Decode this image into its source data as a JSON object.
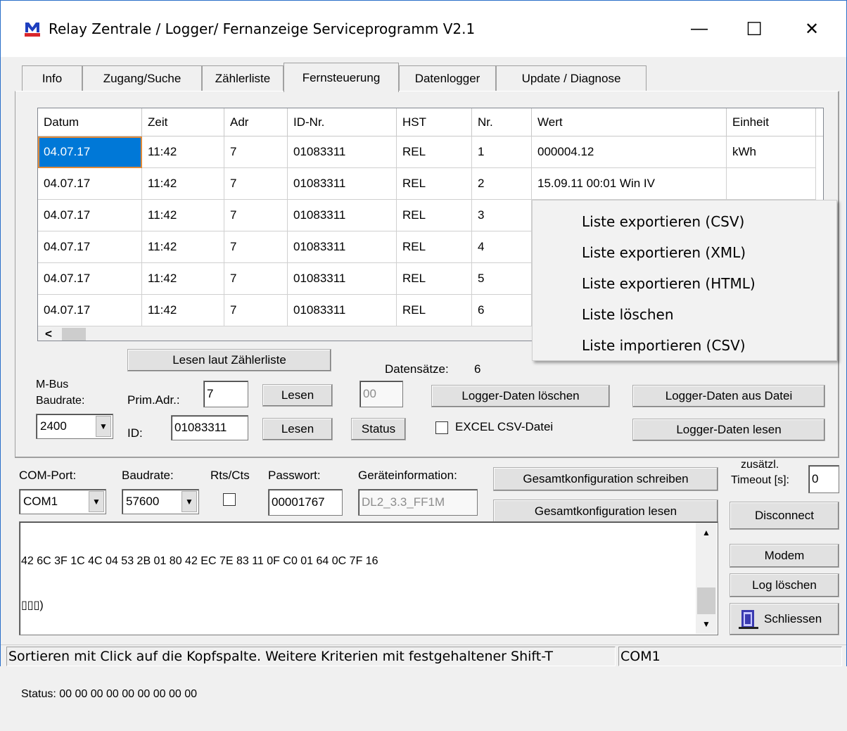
{
  "window": {
    "title": "Relay Zentrale / Logger/ Fernanzeige Serviceprogramm  V2.1",
    "minimize": "—",
    "maximize": "☐",
    "close": "✕"
  },
  "tabs": [
    {
      "label": "Info",
      "active": false
    },
    {
      "label": "Zugang/Suche",
      "active": false
    },
    {
      "label": "Zählerliste",
      "active": false
    },
    {
      "label": "Fernsteuerung",
      "active": true
    },
    {
      "label": "Datenlogger",
      "active": false
    },
    {
      "label": "Update / Diagnose",
      "active": false
    }
  ],
  "grid": {
    "columns": [
      "Datum",
      "Zeit",
      "Adr",
      "ID-Nr.",
      "HST",
      "Nr.",
      "Wert",
      "Einheit"
    ],
    "rows": [
      [
        "04.07.17",
        "11:42",
        "7",
        "01083311",
        "REL",
        "1",
        "000004.12",
        "kWh"
      ],
      [
        "04.07.17",
        "11:42",
        "7",
        "01083311",
        "REL",
        "2",
        "15.09.11 00:01 Win IV",
        ""
      ],
      [
        "04.07.17",
        "11:42",
        "7",
        "01083311",
        "REL",
        "3",
        "",
        ""
      ],
      [
        "04.07.17",
        "11:42",
        "7",
        "01083311",
        "REL",
        "4",
        "",
        ""
      ],
      [
        "04.07.17",
        "11:42",
        "7",
        "01083311",
        "REL",
        "5",
        "",
        ""
      ],
      [
        "04.07.17",
        "11:42",
        "7",
        "01083311",
        "REL",
        "6",
        "",
        ""
      ]
    ],
    "scroll_left_arrow": "<"
  },
  "context_menu": [
    "Liste exportieren (CSV)",
    "Liste exportieren (XML)",
    "Liste exportieren (HTML)",
    "Liste löschen",
    "Liste importieren (CSV)"
  ],
  "controls": {
    "lesen_laut_zaehlerliste": "Lesen laut Zählerliste",
    "datensaetze_label": "Datensätze:",
    "datensaetze_count": "6",
    "mbus_label_1": "M-Bus",
    "mbus_label_2": "Baudrate:",
    "mbus_baudrate": "2400",
    "prim_adr_label": "Prim.Adr.:",
    "prim_adr_value": "7",
    "id_label": "ID:",
    "id_value": "01083311",
    "lesen_1": "Lesen",
    "lesen_2": "Lesen",
    "small_field": "00",
    "status_button": "Status",
    "logger_loeschen": "Logger-Daten löschen",
    "excel_csv": "EXCEL CSV-Datei",
    "logger_aus_datei": "Logger-Daten aus Datei",
    "logger_lesen": "Logger-Daten lesen"
  },
  "connection": {
    "com_port_label": "COM-Port:",
    "com_port_value": "COM1",
    "baudrate_label": "Baudrate:",
    "baudrate_value": "57600",
    "rts_cts_label": "Rts/Cts",
    "passwort_label": "Passwort:",
    "passwort_value": "00001767",
    "geraeteinfo_label": "Geräteinformation:",
    "geraeteinfo_value": "DL2_3.3_FF1M",
    "gesamt_schreiben": "Gesamtkonfiguration schreiben",
    "gesamt_lesen": "Gesamtkonfiguration lesen",
    "timeout_label_1": "zusätzl.",
    "timeout_label_2": "Timeout [s]:",
    "timeout_value": "0",
    "disconnect": "Disconnect",
    "modem": "Modem",
    "log_loeschen": "Log löschen",
    "schliessen": "Schliessen"
  },
  "log": {
    "lines": [
      "42 6C 3F 1C 4C 04 53 2B 01 80 42 EC 7E 83 11 0F C0 01 64 0C 7F 16",
      "▯▯▯)",
      "▯▯▯)",
      "Status: 00 00 00 00 00 00 00 00 00"
    ]
  },
  "statusbar": {
    "hint": "Sortieren mit Click auf die Kopfspalte. Weitere Kriterien mit festgehaltener Shift-T",
    "port": "COM1"
  },
  "colors": {
    "selection": "#0078d7",
    "focus_outline": "#e08a3a",
    "window_border": "#2a6fc9"
  }
}
